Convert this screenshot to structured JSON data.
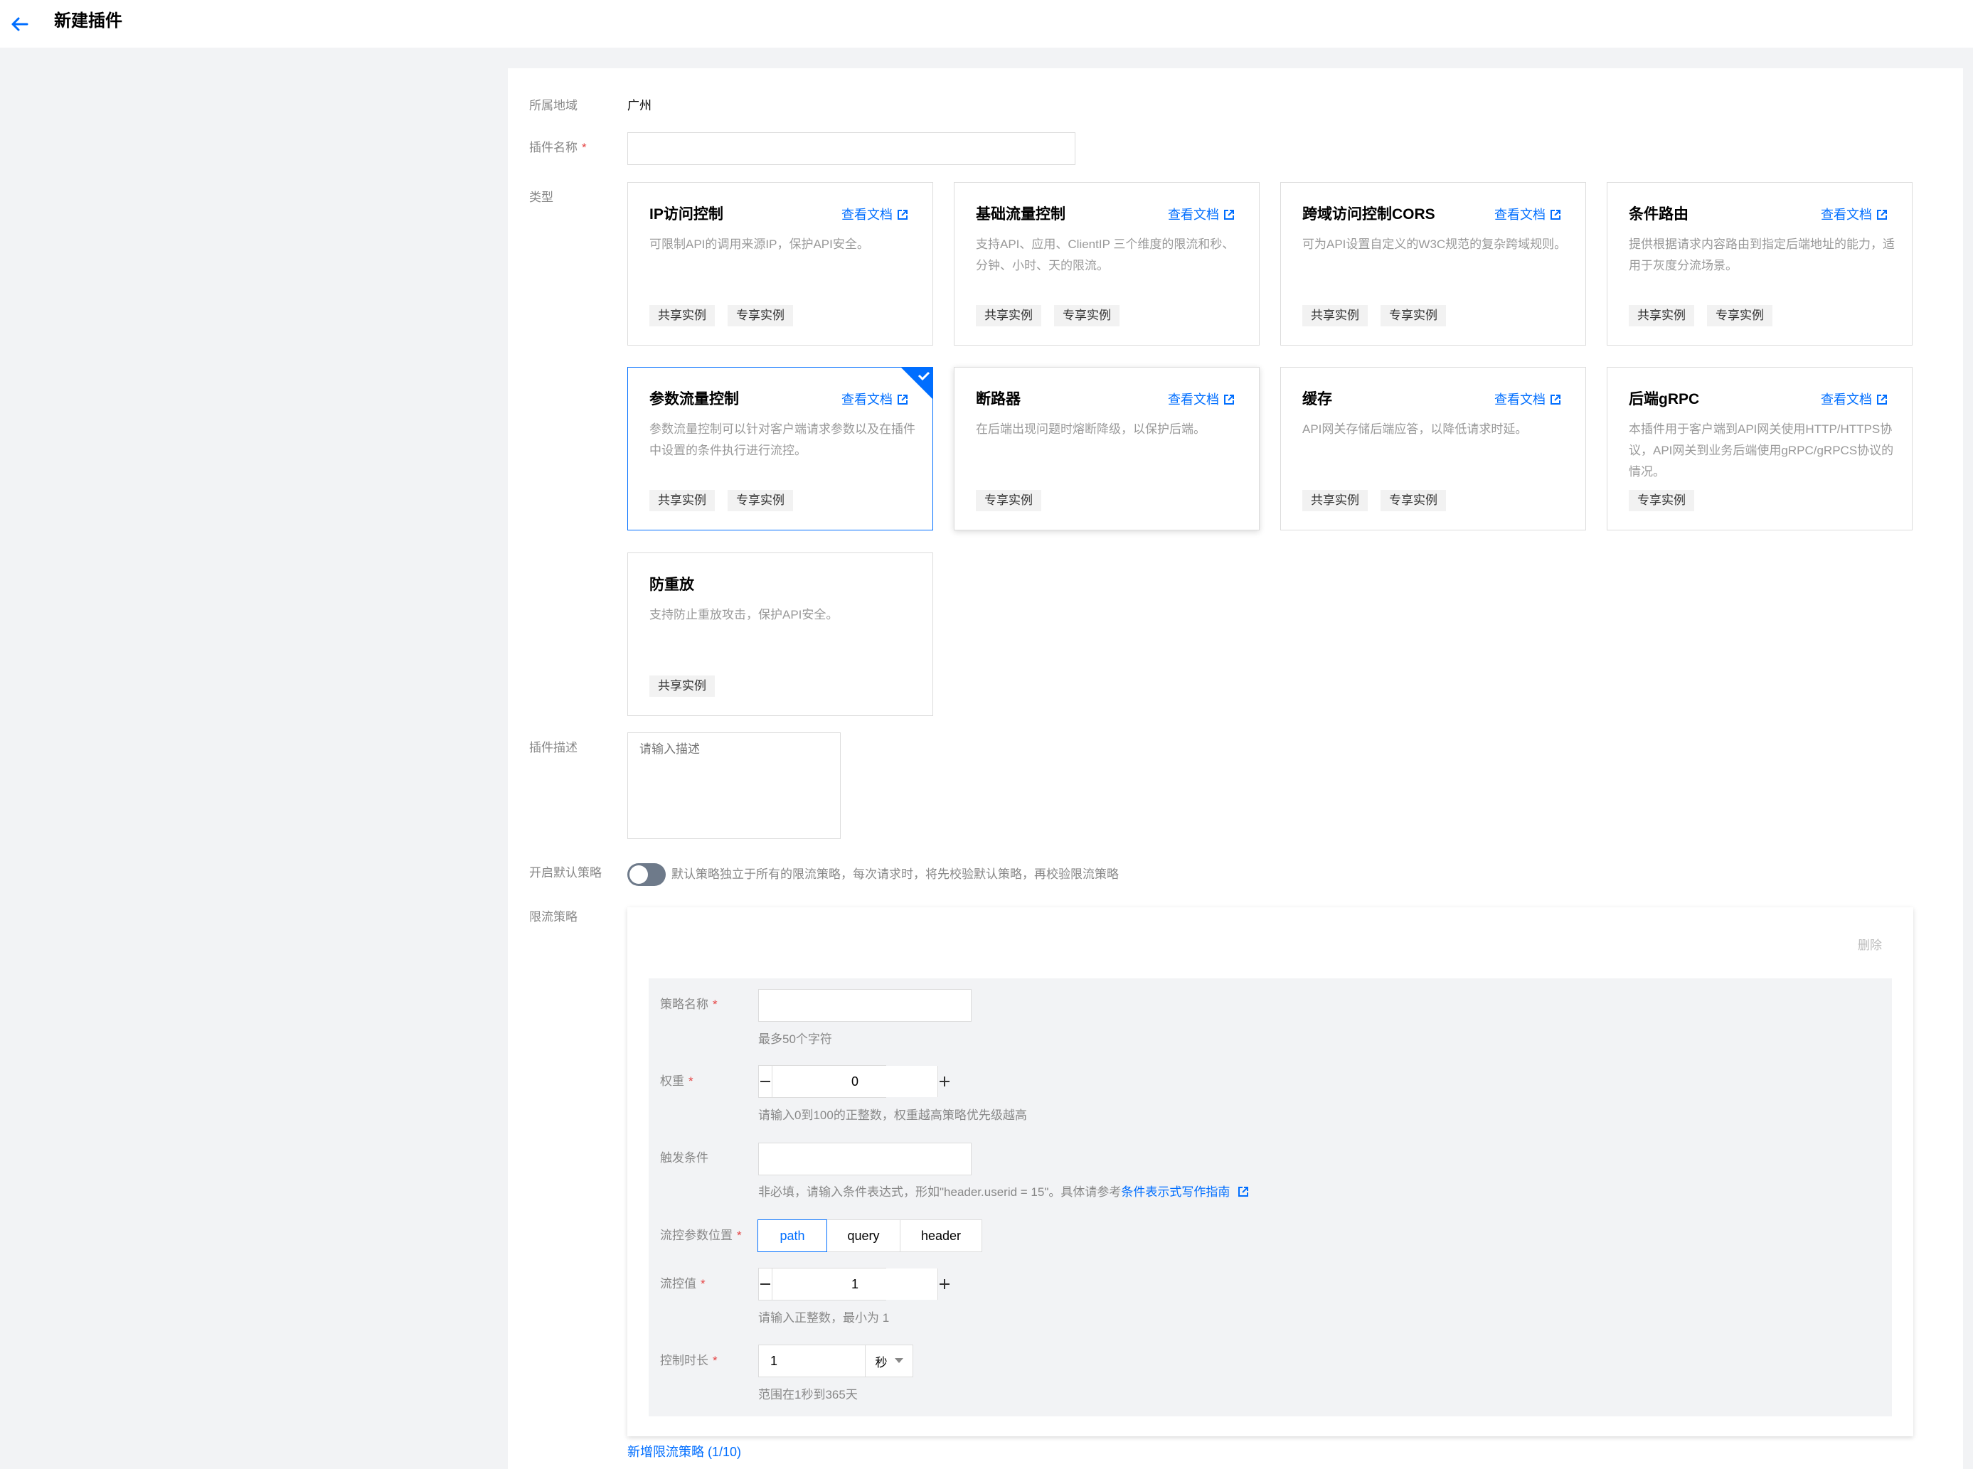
{
  "header": {
    "title": "新建插件"
  },
  "form": {
    "region_label": "所属地域",
    "region_value": "广州",
    "name_label": "插件名称",
    "name_value": "",
    "type_label": "类型",
    "desc_label": "插件描述",
    "desc_placeholder": "请输入描述",
    "default_policy_label": "开启默认策略",
    "default_policy_enabled": false,
    "default_policy_hint": "默认策略独立于所有的限流策略，每次请求时，将先校验默认策略，再校验限流策略",
    "rate_policy_label": "限流策略",
    "required_mark": "*"
  },
  "plugin_types": [
    {
      "title": "IP访问控制",
      "doc": "查看文档",
      "desc": "可限制API的调用来源IP，保护API安全。",
      "tags": [
        "共享实例",
        "专享实例"
      ],
      "selected": false
    },
    {
      "title": "基础流量控制",
      "doc": "查看文档",
      "desc": "支持API、应用、ClientIP 三个维度的限流和秒、分钟、小时、天的限流。",
      "tags": [
        "共享实例",
        "专享实例"
      ],
      "selected": false
    },
    {
      "title": "跨域访问控制CORS",
      "doc": "查看文档",
      "desc": "可为API设置自定义的W3C规范的复杂跨域规则。",
      "tags": [
        "共享实例",
        "专享实例"
      ],
      "selected": false
    },
    {
      "title": "条件路由",
      "doc": "查看文档",
      "desc": "提供根据请求内容路由到指定后端地址的能力，适用于灰度分流场景。",
      "tags": [
        "共享实例",
        "专享实例"
      ],
      "selected": false
    },
    {
      "title": "参数流量控制",
      "doc": "查看文档",
      "desc": "参数流量控制可以针对客户端请求参数以及在插件中设置的条件执行进行流控。",
      "tags": [
        "共享实例",
        "专享实例"
      ],
      "selected": true
    },
    {
      "title": "断路器",
      "doc": "查看文档",
      "desc": "在后端出现问题时熔断降级，以保护后端。",
      "tags": [
        "专享实例"
      ],
      "selected": false
    },
    {
      "title": "缓存",
      "doc": "查看文档",
      "desc": "API网关存储后端应答，以降低请求时延。",
      "tags": [
        "共享实例",
        "专享实例"
      ],
      "selected": false
    },
    {
      "title": "后端gRPC",
      "doc": "查看文档",
      "desc": "本插件用于客户端到API网关使用HTTP/HTTPS协议，API网关到业务后端使用gRPC/gRPCS协议的情况。",
      "tags": [
        "专享实例"
      ],
      "selected": false
    },
    {
      "title": "防重放",
      "doc": "",
      "desc": "支持防止重放攻击，保护API安全。",
      "tags": [
        "共享实例"
      ],
      "selected": false
    }
  ],
  "policy": {
    "delete_label": "删除",
    "name_label": "策略名称",
    "name_value": "",
    "name_hint": "最多50个字符",
    "weight_label": "权重",
    "weight_value": "0",
    "weight_hint": "请输入0到100的正整数，权重越高策略优先级越高",
    "trigger_label": "触发条件",
    "trigger_value": "",
    "trigger_hint": "非必填，请输入条件表达式，形如\"header.userid = 15\"。具体请参考",
    "trigger_hint_link": "条件表示式写作指南",
    "location_label": "流控参数位置",
    "location_options": [
      "path",
      "query",
      "header"
    ],
    "location_selected": "path",
    "limit_label": "流控值",
    "limit_value": "1",
    "limit_hint": "请输入正整数，最小为 1",
    "duration_label": "控制时长",
    "duration_value": "1",
    "duration_unit": "秒",
    "duration_hint": "范围在1秒到365天"
  },
  "add_policy_label": "新增限流策略 (1/10)",
  "colors": {
    "primary": "#006eff",
    "required": "#e54545",
    "toggle_off": "#6e7a8a"
  }
}
